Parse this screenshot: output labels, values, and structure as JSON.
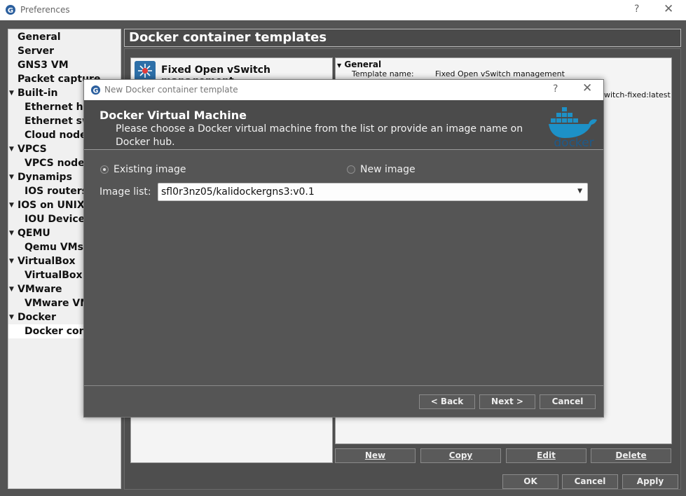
{
  "window": {
    "title": "Preferences",
    "help": "?",
    "close": "✕"
  },
  "tree": {
    "items": [
      {
        "label": "General",
        "level": 0,
        "arrow": ""
      },
      {
        "label": "Server",
        "level": 0,
        "arrow": ""
      },
      {
        "label": "GNS3 VM",
        "level": 0,
        "arrow": ""
      },
      {
        "label": "Packet capture",
        "level": 0,
        "arrow": ""
      },
      {
        "label": "Built-in",
        "level": 0,
        "arrow": "▼"
      },
      {
        "label": "Ethernet hubs",
        "level": 1,
        "arrow": ""
      },
      {
        "label": "Ethernet switches",
        "level": 1,
        "arrow": ""
      },
      {
        "label": "Cloud nodes",
        "level": 1,
        "arrow": ""
      },
      {
        "label": "VPCS",
        "level": 0,
        "arrow": "▼"
      },
      {
        "label": "VPCS nodes",
        "level": 1,
        "arrow": ""
      },
      {
        "label": "Dynamips",
        "level": 0,
        "arrow": "▼"
      },
      {
        "label": "IOS routers",
        "level": 1,
        "arrow": ""
      },
      {
        "label": "IOS on UNIX",
        "level": 0,
        "arrow": "▼"
      },
      {
        "label": "IOU Devices",
        "level": 1,
        "arrow": ""
      },
      {
        "label": "QEMU",
        "level": 0,
        "arrow": "▼"
      },
      {
        "label": "Qemu VMs",
        "level": 1,
        "arrow": ""
      },
      {
        "label": "VirtualBox",
        "level": 0,
        "arrow": "▼"
      },
      {
        "label": "VirtualBox VMs",
        "level": 1,
        "arrow": ""
      },
      {
        "label": "VMware",
        "level": 0,
        "arrow": "▼"
      },
      {
        "label": "VMware VMs",
        "level": 1,
        "arrow": ""
      },
      {
        "label": "Docker",
        "level": 0,
        "arrow": "▼"
      },
      {
        "label": "Docker containers",
        "level": 1,
        "arrow": "",
        "selected": true
      }
    ]
  },
  "panel": {
    "title": "Docker container templates"
  },
  "template": {
    "name": "Fixed Open vSwitch management"
  },
  "props": {
    "section": "General",
    "key": "Template name:",
    "value": "Fixed Open vSwitch management",
    "value2": "witch-fixed:latest",
    "section_arrow": "▼"
  },
  "list_buttons": {
    "new": "New",
    "copy": "Copy",
    "edit": "Edit",
    "delete": "Delete"
  },
  "footer_buttons": {
    "ok": "OK",
    "cancel": "Cancel",
    "apply": "Apply"
  },
  "dialog": {
    "title": "New Docker container template",
    "help": "?",
    "close": "✕",
    "heading": "Docker Virtual Machine",
    "subtitle": "Please choose a Docker virtual machine from the list or provide an image name on Docker hub.",
    "logo_text": "docker",
    "radio_existing": "Existing image",
    "radio_new": "New image",
    "image_list_label": "Image list:",
    "image_list_value": "sfl0r3nz05/kalidockergns3:v0.1",
    "back": "< Back",
    "next": "Next >",
    "cancel": "Cancel"
  },
  "colors": {
    "accent": "#2d6fa8",
    "docker_blue": "#1d91c7"
  }
}
